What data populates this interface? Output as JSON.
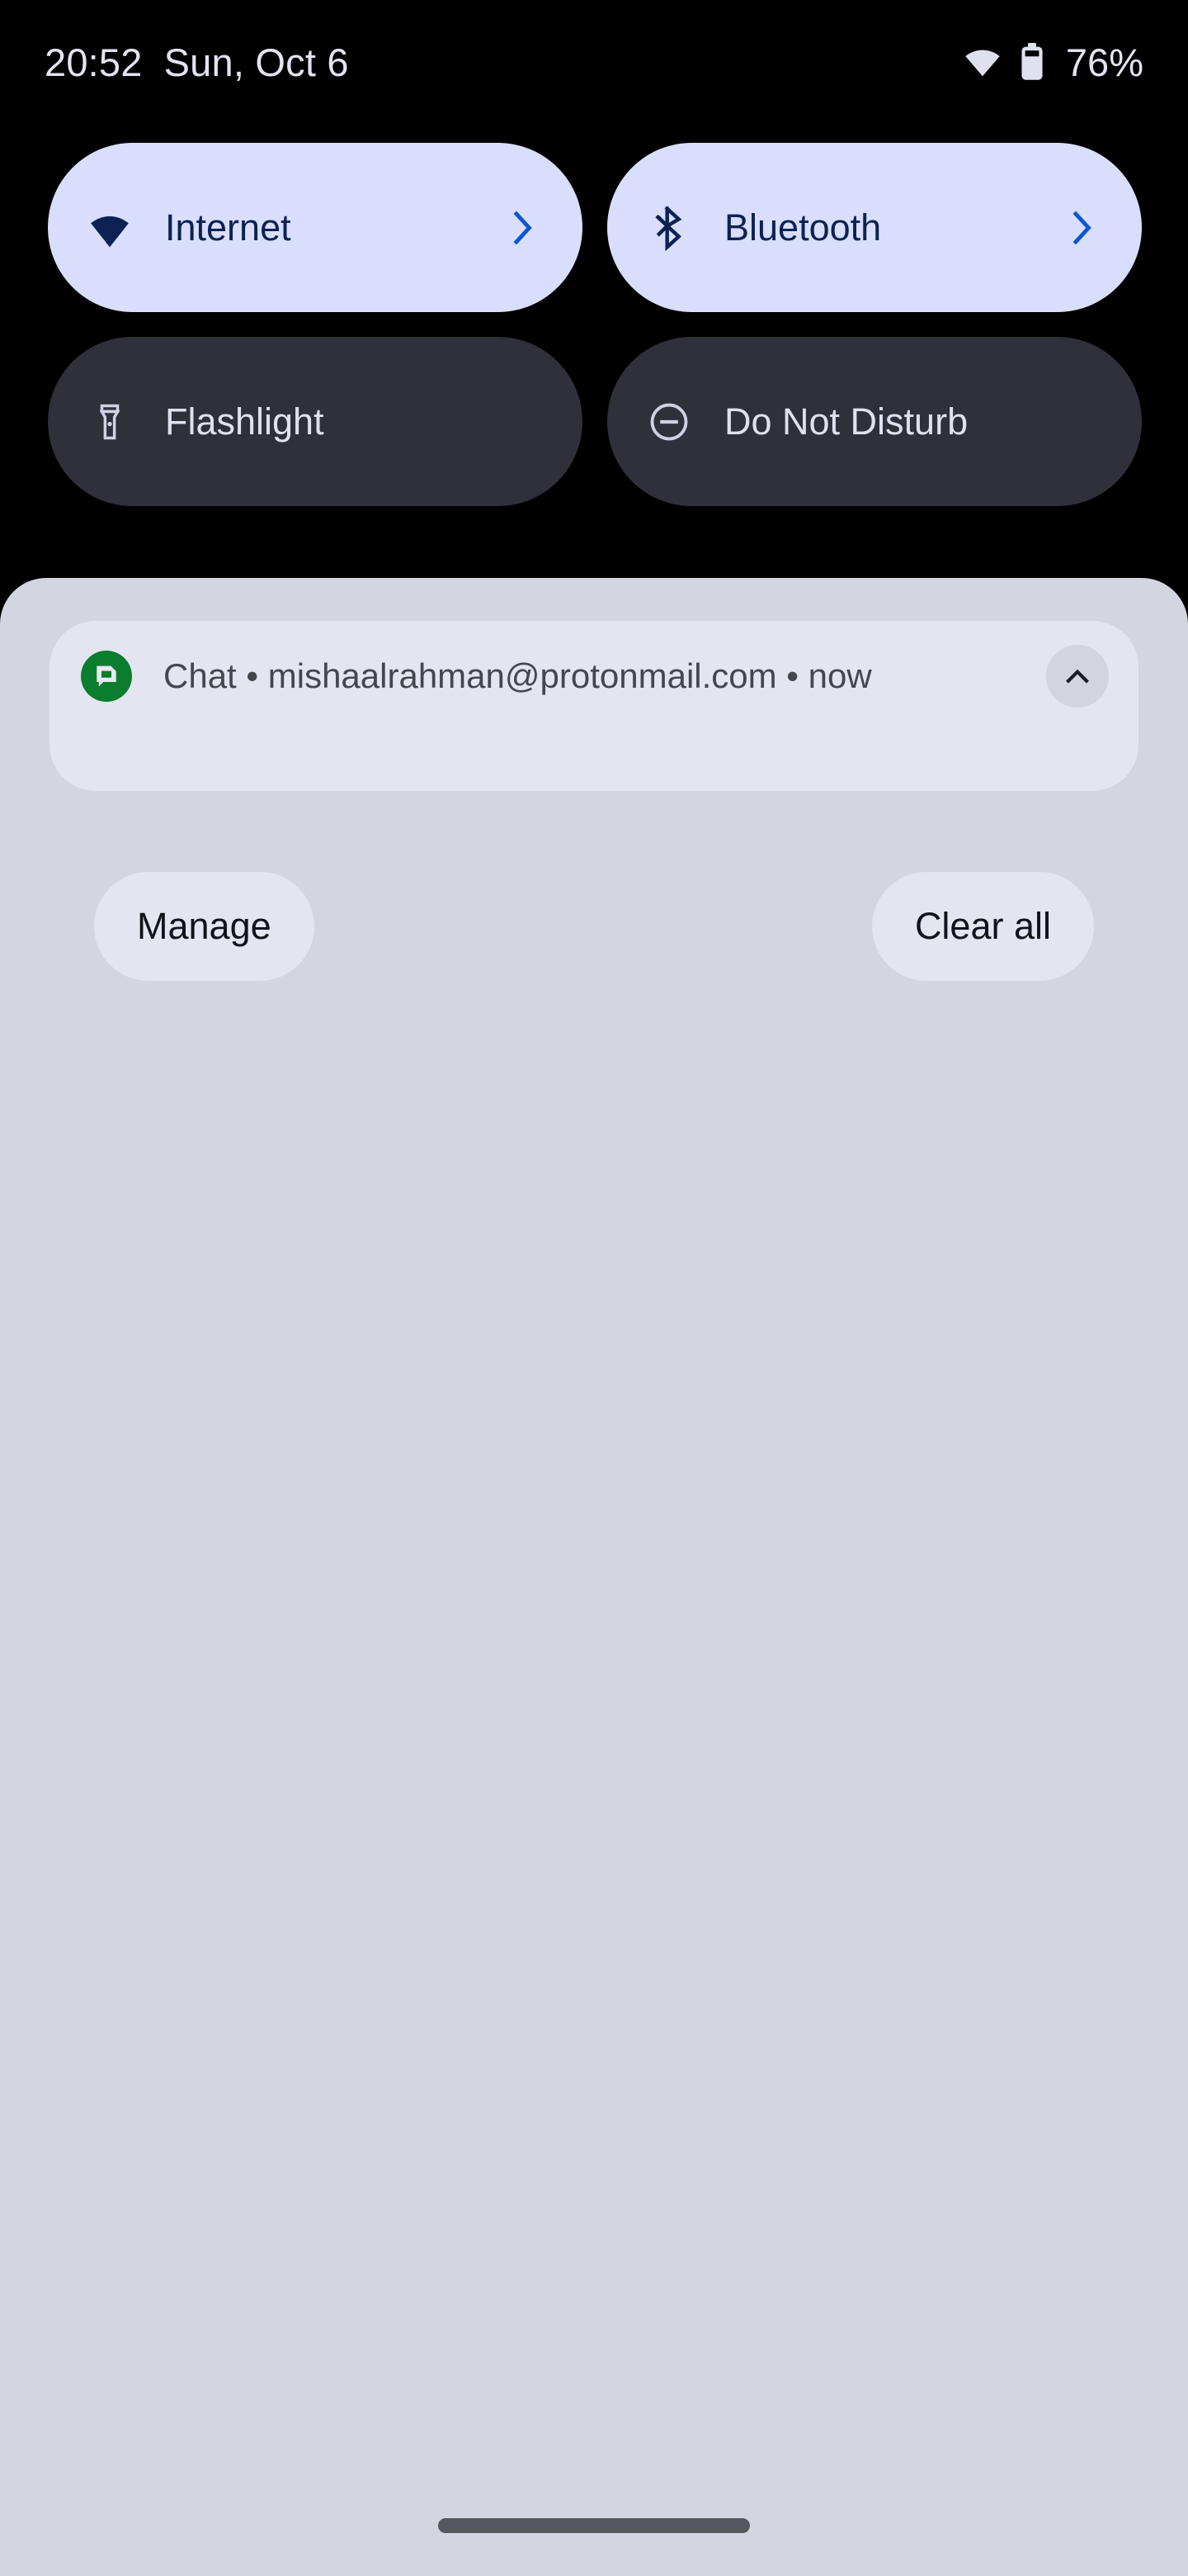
{
  "status_bar": {
    "clock": "20:52",
    "date": "Sun, Oct 6",
    "wifi_icon": "wifi-full-icon",
    "battery_icon": "battery-icon",
    "battery_text": "76%",
    "text_color": "#e3e4f3"
  },
  "quick_settings": {
    "tiles": [
      {
        "label": "Internet",
        "icon": "wifi-icon",
        "state": "active",
        "has_chevron": true,
        "bg": "#d8defb",
        "fg": "#0d2253",
        "chevron_color": "#0b57d0"
      },
      {
        "label": "Bluetooth",
        "icon": "bluetooth-icon",
        "state": "active",
        "has_chevron": true,
        "bg": "#d8defb",
        "fg": "#0d2253",
        "chevron_color": "#0b57d0"
      },
      {
        "label": "Flashlight",
        "icon": "flashlight-icon",
        "state": "inactive",
        "has_chevron": false,
        "bg": "#2f3039",
        "fg": "#dfe1ef"
      },
      {
        "label": "Do Not Disturb",
        "icon": "do-not-disturb-icon",
        "state": "inactive",
        "has_chevron": false,
        "bg": "#2f3039",
        "fg": "#dfe1ef"
      }
    ]
  },
  "shade": {
    "background": "#d3d5e1",
    "notification": {
      "app_icon": "google-chat-icon",
      "app_icon_color": "#0b7d2e",
      "app_name": "Chat",
      "separator": "•",
      "account": "mishaalrahman@protonmail.com",
      "time": "now",
      "summary_text": "Chat • mishaalrahman@protonmail.com • now",
      "expand_icon": "chevron-up-icon",
      "card_background": "#e3e5f0"
    },
    "actions": {
      "manage_label": "Manage",
      "clear_all_label": "Clear all"
    }
  },
  "navigation": {
    "gesture_pill": "home-gesture-pill",
    "color": "#55575e"
  }
}
